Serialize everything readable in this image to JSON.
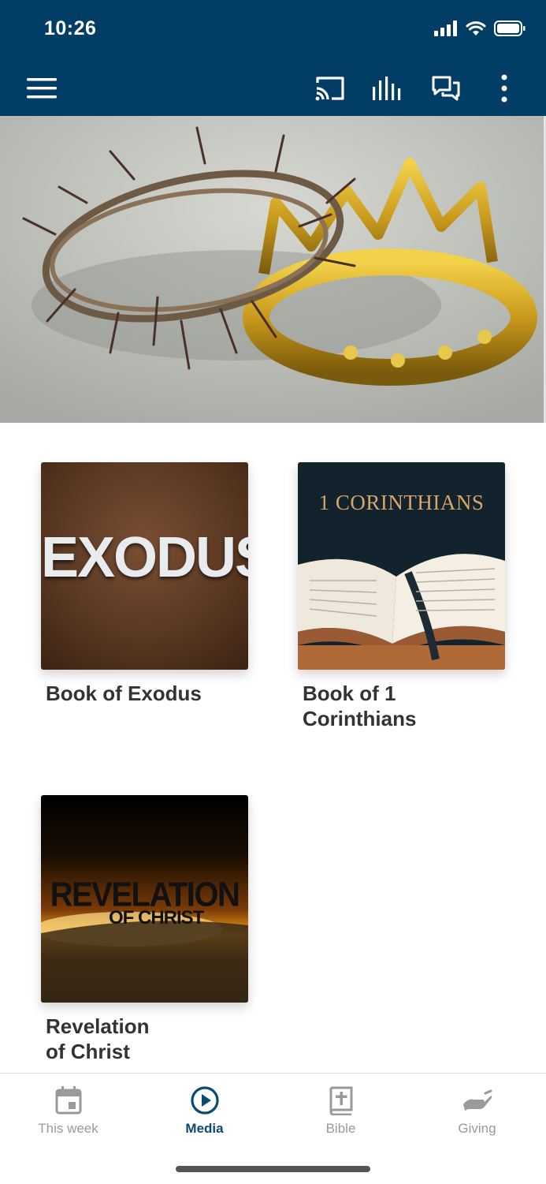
{
  "status_bar": {
    "time": "10:26"
  },
  "toolbar": {
    "icons": [
      "menu-icon",
      "cast-icon",
      "audio-bars-icon",
      "chat-icon",
      "more-vertical-icon"
    ]
  },
  "hero": {
    "alt": "crown-of-thorns-and-golden-crown"
  },
  "cards": [
    {
      "title": "Book of Exodus",
      "art_text": "EXODUS"
    },
    {
      "title": "Book of 1 Corinthians",
      "art_text": "1 CORINTHIANS"
    },
    {
      "title": "Revelation of Christ",
      "art_text": "REVELATION",
      "art_sub": "OF CHRIST"
    }
  ],
  "tabs": [
    {
      "label": "This week",
      "icon": "calendar-icon",
      "active": false
    },
    {
      "label": "Media",
      "icon": "play-circle-icon",
      "active": true
    },
    {
      "label": "Bible",
      "icon": "bible-icon",
      "active": false
    },
    {
      "label": "Giving",
      "icon": "giving-hand-icon",
      "active": false
    }
  ],
  "colors": {
    "header": "#023d66",
    "active_tab": "#0b4a73",
    "inactive_tab": "#9a9a9a",
    "card_title": "#333333"
  }
}
